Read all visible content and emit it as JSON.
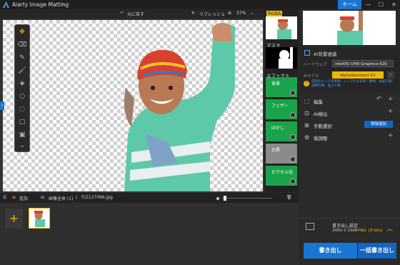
{
  "titlebar": {
    "app_title": "Aiarty Image Matting",
    "home_label": "ホーム",
    "minimize": "—",
    "maximize": "☐",
    "close": "✕"
  },
  "toolbar": {
    "undo_label": "元に戻す",
    "refresh_label": "リフレッシュ",
    "zoom": "37%"
  },
  "thumb_column": {
    "rgba_label": "RGBA",
    "mask_label": "マスク",
    "effect_label": "エフェクト",
    "effects": [
      {
        "label": "背景"
      },
      {
        "label": "フェザー"
      },
      {
        "label": "ぼかし"
      },
      {
        "label": "白黒"
      },
      {
        "label": "ピクセル化"
      }
    ]
  },
  "bottombar": {
    "add_label": "追加",
    "all_images_label": "画像全体 (1)",
    "filename": "f15127096.jpg"
  },
  "right_panel": {
    "ai_bg_label": "AI背景透過",
    "hardware_label": "ハードウェア",
    "hardware_value": "Intel(R) UHD Graphics 620",
    "ai_model_label": "AIモデル",
    "ai_model_value": "AlphaStandard V2",
    "model_desc": "自然なエッジを再現。シンプルな背景・動物、商品写真、証明写真、並ぶ人物...",
    "edit_label": "編集",
    "ai_detect_label": "AI検出",
    "manual_select_label": "手動選択",
    "area_add_label": "領域追加",
    "fine_tune_label": "微調整",
    "export_settings_label": "書き出し設定",
    "export_size": "2400 X 1598",
    "export_format": "PNG",
    "export_bits": "[8 bits]",
    "export_label": "書き出し",
    "batch_export_label": "一括書き出し"
  }
}
